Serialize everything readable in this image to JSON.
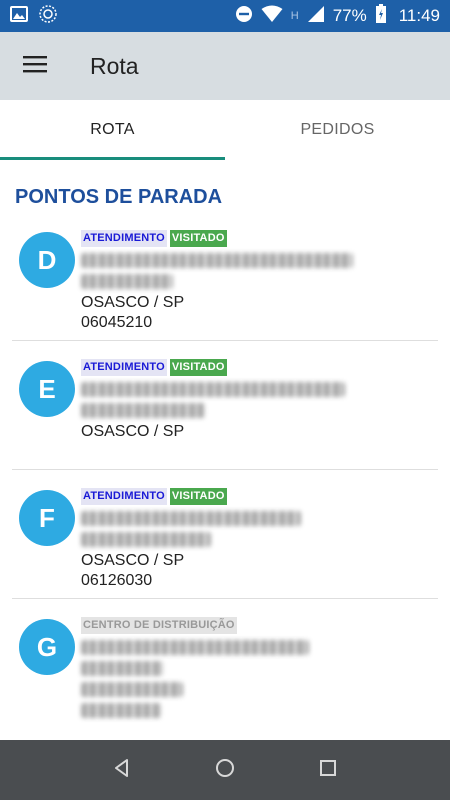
{
  "status_bar": {
    "battery_percent": "77%",
    "time": "11:49",
    "network_label": "H"
  },
  "app_bar": {
    "title": "Rota"
  },
  "tabs": [
    {
      "label": "ROTA",
      "active": true
    },
    {
      "label": "PEDIDOS",
      "active": false
    }
  ],
  "section_title": "PONTOS DE PARADA",
  "stops": [
    {
      "letter": "D",
      "badge_type": "ATENDIMENTO",
      "badge_status": "VISITADO",
      "city": "OSASCO / SP",
      "zip": "06045210"
    },
    {
      "letter": "E",
      "badge_type": "ATENDIMENTO",
      "badge_status": "VISITADO",
      "city": "OSASCO / SP",
      "zip": ""
    },
    {
      "letter": "F",
      "badge_type": "ATENDIMENTO",
      "badge_status": "VISITADO",
      "city": "OSASCO / SP",
      "zip": "06126030"
    },
    {
      "letter": "G",
      "badge_type": "CENTRO DE DISTRIBUIÇÃO",
      "badge_status": "",
      "city": "",
      "zip": ""
    }
  ],
  "colors": {
    "status_bar": "#1e60a8",
    "app_bar": "#d7dde1",
    "accent": "#188d7c",
    "section_title": "#1e4f9c",
    "avatar": "#2eaae2",
    "badge_blue_text": "#1a1ad6",
    "badge_green": "#4aa84e",
    "nav_bar": "#4a4d50"
  },
  "icons": {
    "status_left": [
      "gallery-icon",
      "sync-icon"
    ],
    "status_right": [
      "do-not-disturb-icon",
      "wifi-icon",
      "signal-icon",
      "battery-icon"
    ],
    "app_bar": "menu-icon",
    "nav": [
      "back-icon",
      "home-icon",
      "recents-icon"
    ]
  }
}
